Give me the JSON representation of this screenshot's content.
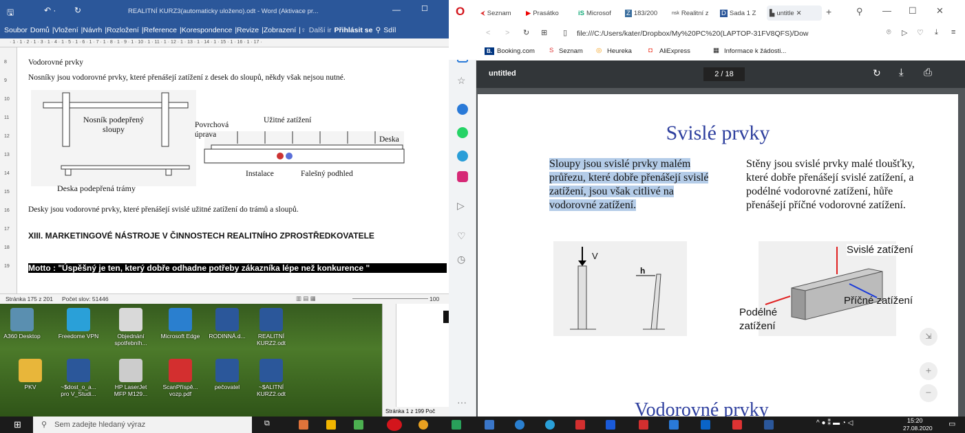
{
  "word": {
    "title": "REALITNÍ KURZ3(automaticky uloženo).odt - Word (Aktivace pr...",
    "menu": [
      "Soubor",
      "Domů",
      "Vložení",
      "Návrh",
      "Rozložení",
      "Reference",
      "Korespondence",
      "Revize",
      "Zobrazení"
    ],
    "search_placeholder": "Další ir",
    "signin": "Přihlásit se",
    "share": "Sdíl",
    "ruler": "· 1 · 1 · 2 · 1 · 3 · 1 · 4 · 1 · 5 · 1 · 6 · 1 · 7 · 1 · 8 · 1 · 9 · 1 · 10 · 1 · 11 · 1 · 12 · 1 · 13 · 1 · 14 · 1 · 15 · 1 · 16 · 1 · 17 ·",
    "vruler": [
      "8",
      "9",
      "10",
      "11",
      "12",
      "13",
      "14",
      "15",
      "16",
      "17",
      "18",
      "19"
    ],
    "heading1": "Vodorovné prvky",
    "para1": "Nosníky jsou vodorovné prvky, které přenášejí zatížení z desek do sloupů, někdy však nejsou nutné.",
    "fig": {
      "beam_label": "Nosník podepřený sloupy",
      "slab_label": "Deska podepřená trámy",
      "surface": "Povrchová úprava",
      "load": "Užitné zatížení",
      "slab": "Deska",
      "install": "Instalace",
      "ceiling": "Falešný podhled"
    },
    "para2": "Desky jsou vodorovné prvky, které přenášejí svislé užitné zatížení do trámů a sloupů.",
    "heading2": "XIII.   MARKETINGOVÉ   NÁSTROJE   V   ČINNOSTECH   REALITNÍHO ZPROSTŘEDKOVATELE",
    "motto": "Motto : \"Úspěšný je ten, který dobře odhadne potřeby zákazníka lépe než konkurence \"",
    "status_page": "Stránka 175 z 201",
    "status_words": "Počet slov: 51446",
    "zoom": "100"
  },
  "desktop": {
    "icons": [
      {
        "label": "A360 Desktop",
        "color": "#5a8fb0"
      },
      {
        "label": "Freedome VPN",
        "color": "#2aa0d8"
      },
      {
        "label": "Objednání spotřebníh...",
        "color": "#d9d9d9"
      },
      {
        "label": "Microsoft Edge",
        "color": "#2a7fcf"
      },
      {
        "label": "RODINNÁ.d...",
        "color": "#2b579a"
      },
      {
        "label": "REALITNÍ KURZ2.odt",
        "color": "#2b579a"
      },
      {
        "label": "PKV",
        "color": "#e8b63a"
      },
      {
        "label": "~$dost_o_a... pro V_Studi...",
        "color": "#2b579a"
      },
      {
        "label": "HP LaserJet MFP M129...",
        "color": "#ccc"
      },
      {
        "label": "ScanPříspě... vozp.pdf",
        "color": "#d32f2f"
      },
      {
        "label": "pečovatel",
        "color": "#2b579a"
      },
      {
        "label": "~$ALITNÍ KURZ2.odt",
        "color": "#2b579a"
      }
    ],
    "small_status": "Stránka 1 z 199",
    "small_status2": "Poč"
  },
  "browser": {
    "tabs": [
      "Seznam",
      "Prasátko",
      "Microsof",
      "183/200",
      "Realitní z",
      "Sada 1 Z",
      "untitle"
    ],
    "url": "file:///C:/Users/kater/Dropbox/My%20PC%20(LAPTOP-31FV8QFS)/Dow",
    "bookmarks": [
      "Booking.com",
      "Seznam",
      "Heureka",
      "AliExpress",
      "Informace k žádosti..."
    ],
    "pdf_title": "untitled",
    "pdf_page": "2 / 18",
    "slide": {
      "title": "Svislé prvky",
      "left": "Sloupy jsou svislé prvky malém průřezu, které dobře přenášejí svislé zatížení, jsou však citlivé na vodorovné zatížení.",
      "right": "Stěny jsou svislé prvky malé tloušťky, které dobře přenášejí svislé zatížení, a podélné vodorovné zatížení, hůře přenášejí příčné vodorovné zatížení.",
      "v": "V",
      "h": "h",
      "vertical_load": "Svislé zatížení",
      "transverse_load": "Příčné zatížení",
      "longitudinal_load": "Podélné zatížení",
      "next_title": "Vodorovné prvky"
    }
  },
  "taskbar": {
    "search": "Sem zadejte hledaný výraz",
    "time": "15:20",
    "date": "27.08.2020"
  }
}
